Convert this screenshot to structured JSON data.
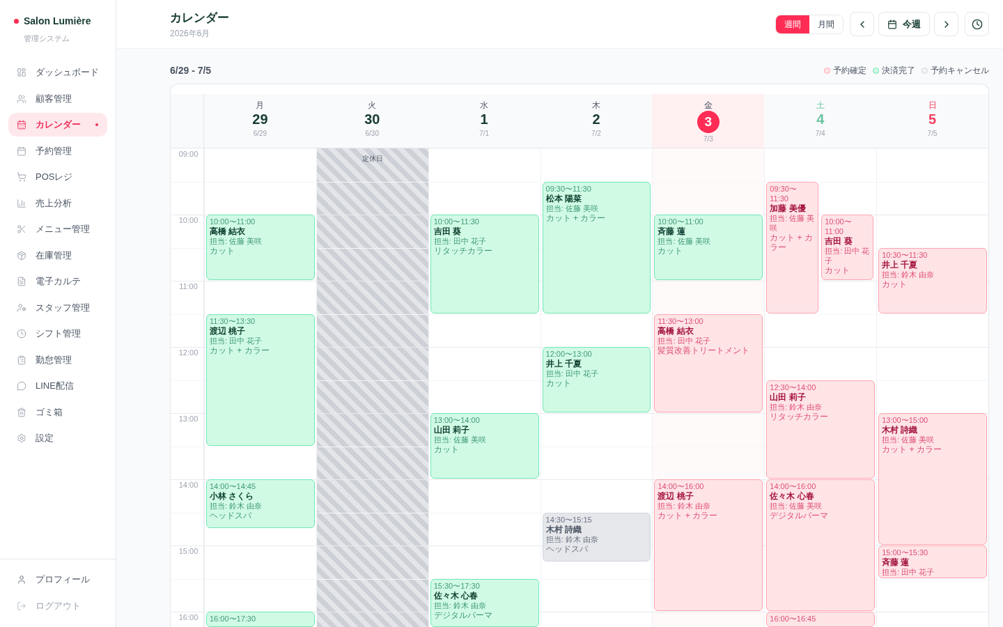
{
  "sidebar": {
    "brand": {
      "name": "Salon Lumière",
      "subtitle": "管理システム"
    },
    "items": [
      {
        "label": "ダッシュボード",
        "selected": false
      },
      {
        "label": "顧客管理",
        "selected": false
      },
      {
        "label": "カレンダー",
        "selected": true
      },
      {
        "label": "予約管理",
        "selected": false
      },
      {
        "label": "POSレジ",
        "selected": false
      },
      {
        "label": "売上分析",
        "selected": false
      },
      {
        "label": "メニュー管理",
        "selected": false
      },
      {
        "label": "在庫管理",
        "selected": false
      },
      {
        "label": "電子カルテ",
        "selected": false
      },
      {
        "label": "スタッフ管理",
        "selected": false
      },
      {
        "label": "シフト管理",
        "selected": false
      },
      {
        "label": "勤怠管理",
        "selected": false
      },
      {
        "label": "LINE配信",
        "selected": false
      },
      {
        "label": "ゴミ箱",
        "selected": false
      },
      {
        "label": "設定",
        "selected": false
      }
    ],
    "footer_items": [
      {
        "label": "プロフィール",
        "muted": false
      },
      {
        "label": "ログアウト",
        "muted": true
      }
    ]
  },
  "header": {
    "title": "カレンダー",
    "subtitle": "2026年6月",
    "view_tabs": [
      {
        "label": "週間",
        "selected": true
      },
      {
        "label": "月間",
        "selected": false
      }
    ],
    "today_button": "今週"
  },
  "calendar": {
    "range": "6/29 - 7/5",
    "legend": [
      {
        "kind": "confirmed",
        "label": "予約確定",
        "color": "#ffe4e6"
      },
      {
        "kind": "paid",
        "label": "決済完了",
        "color": "#d1fae5"
      },
      {
        "kind": "cancelled",
        "label": "予約キャンセル",
        "color": "#f3f4f6"
      }
    ],
    "time_labels": [
      "09:00",
      "10:00",
      "11:00",
      "12:00",
      "13:00",
      "14:00",
      "15:00",
      "16:00"
    ],
    "days": [
      {
        "weekday": "月",
        "day": "29",
        "date": "6/29",
        "kind": "weekday",
        "today": false,
        "closed": false,
        "events": [
          {
            "time": "10:00〜11:00",
            "name": "高橋 結衣",
            "staff": "担当: 佐藤 美咲",
            "service": "カット",
            "kind": "paid"
          },
          {
            "time": "11:30〜13:30",
            "name": "渡辺 桃子",
            "staff": "担当: 田中 花子",
            "service": "カット + カラー",
            "kind": "paid"
          },
          {
            "time": "14:00〜14:45",
            "name": "小林 さくら",
            "staff": "担当: 鈴木 由奈",
            "service": "ヘッドスパ",
            "kind": "paid"
          },
          {
            "time": "16:00〜17:30",
            "kind": "paid"
          }
        ]
      },
      {
        "weekday": "火",
        "day": "30",
        "date": "6/30",
        "kind": "weekday",
        "today": false,
        "closed": true,
        "closed_label": "定休日"
      },
      {
        "weekday": "水",
        "day": "1",
        "date": "7/1",
        "kind": "weekday",
        "today": false,
        "closed": false,
        "events": [
          {
            "time": "10:00〜11:30",
            "name": "吉田 葵",
            "staff": "担当: 田中 花子",
            "service": "リタッチカラー",
            "kind": "paid"
          },
          {
            "time": "13:00〜14:00",
            "name": "山田 莉子",
            "staff": "担当: 佐藤 美咲",
            "service": "カット",
            "kind": "paid"
          },
          {
            "time": "15:30〜17:30",
            "name": "佐々木 心春",
            "staff": "担当: 鈴木 由奈",
            "service": "デジタルパーマ",
            "kind": "paid"
          }
        ]
      },
      {
        "weekday": "木",
        "day": "2",
        "date": "7/2",
        "kind": "weekday",
        "today": false,
        "closed": false,
        "events": [
          {
            "time": "09:30〜11:30",
            "name": "松本 陽菜",
            "staff": "担当: 佐藤 美咲",
            "service": "カット + カラー",
            "kind": "paid"
          },
          {
            "time": "12:00〜13:00",
            "name": "井上 千夏",
            "staff": "担当: 田中 花子",
            "service": "カット",
            "kind": "paid"
          },
          {
            "time": "14:30〜15:15",
            "name": "木村 詩織",
            "staff": "担当: 鈴木 由奈",
            "service": "ヘッドスパ",
            "kind": "cancelled"
          }
        ]
      },
      {
        "weekday": "金",
        "day": "3",
        "date": "7/3",
        "kind": "weekday",
        "today": true,
        "closed": false,
        "events": [
          {
            "time": "10:00〜11:00",
            "name": "斉藤 蓮",
            "staff": "担当: 佐藤 美咲",
            "service": "カット",
            "kind": "paid"
          },
          {
            "time": "11:30〜13:00",
            "name": "高橋 結衣",
            "staff": "担当: 田中 花子",
            "service": "髪質改善トリートメント",
            "kind": "confirmed"
          },
          {
            "time": "14:00〜16:00",
            "name": "渡辺 桃子",
            "staff": "担当: 鈴木 由奈",
            "service": "カット + カラー",
            "kind": "confirmed"
          }
        ]
      },
      {
        "weekday": "土",
        "day": "4",
        "date": "7/4",
        "kind": "saturday",
        "today": false,
        "closed": false,
        "events": [
          {
            "time": "09:30〜11:30",
            "name": "加藤 美優",
            "staff": "担当: 佐藤 美咲",
            "service": "カット + カラー",
            "kind": "confirmed"
          },
          {
            "time": "10:00〜11:00",
            "name": "吉田 葵",
            "staff": "担当: 田中 花子",
            "service": "カット",
            "kind": "confirmed"
          },
          {
            "time": "12:30〜14:00",
            "name": "山田 莉子",
            "staff": "担当: 鈴木 由奈",
            "service": "リタッチカラー",
            "kind": "confirmed"
          },
          {
            "time": "14:00〜16:00",
            "name": "佐々木 心春",
            "staff": "担当: 佐藤 美咲",
            "service": "デジタルパーマ",
            "kind": "confirmed"
          },
          {
            "time": "16:00〜16:45",
            "kind": "confirmed"
          }
        ]
      },
      {
        "weekday": "日",
        "day": "5",
        "date": "7/5",
        "kind": "sunday",
        "today": false,
        "closed": false,
        "events": [
          {
            "time": "10:30〜11:30",
            "name": "井上 千夏",
            "staff": "担当: 鈴木 由奈",
            "service": "カット",
            "kind": "confirmed"
          },
          {
            "time": "13:00〜15:00",
            "name": "木村 詩織",
            "staff": "担当: 佐藤 美咲",
            "service": "カット + カラー",
            "kind": "confirmed"
          },
          {
            "time": "15:00〜15:30",
            "name": "斉藤 蓮",
            "staff": "担当: 田中 花子",
            "kind": "confirmed"
          }
        ]
      }
    ]
  }
}
